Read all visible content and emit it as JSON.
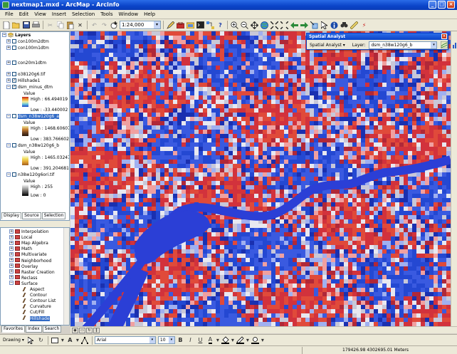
{
  "window": {
    "title": "nextmap1.mxd - ArcMap - ArcInfo",
    "minimize": "_",
    "maximize": "□",
    "close": "×"
  },
  "menu": [
    "File",
    "Edit",
    "View",
    "Insert",
    "Selection",
    "Tools",
    "Window",
    "Help"
  ],
  "toolbar": {
    "scale": "1:24,000",
    "dropdown_arrow": "▾"
  },
  "toc": {
    "root": "Layers",
    "layers": [
      {
        "name": "con100m2dtm",
        "checked": false
      },
      {
        "name": "con100m1dtm",
        "checked": false
      },
      {
        "name": "con20m1dtm",
        "checked": false
      },
      {
        "name": "o38120g6.tif",
        "checked": false
      },
      {
        "name": "Hillshade1",
        "checked": true
      },
      {
        "name": "dsm_minus_dtm",
        "checked": true,
        "legend": {
          "title": "Value",
          "high": "High : 66.494019",
          "low": "Low : -33.440002"
        }
      },
      {
        "name": "dsm_n38w120g6_a",
        "checked": false,
        "selected": true,
        "legend": {
          "title": "Value",
          "high": "High : 1468.606079",
          "low": "Low : 383.766602"
        }
      },
      {
        "name": "dsm_n38w120g6_b",
        "checked": false,
        "legend": {
          "title": "Value",
          "high": "High : 1465.032471",
          "low": "Low : 391.204681"
        }
      },
      {
        "name": "n38w120g6ori.tif",
        "checked": false,
        "legend": {
          "title": "Value",
          "high": "High : 255",
          "low": "Low : 0"
        }
      }
    ],
    "tabs": [
      "Display",
      "Source",
      "Selection"
    ]
  },
  "toolbox": {
    "items": [
      "Interpolation",
      "Local",
      "Map Algebra",
      "Math",
      "Multivariate",
      "Neighborhood",
      "Overlay",
      "Raster Creation",
      "Reclass",
      "Surface"
    ],
    "surface_tools": [
      "Aspect",
      "Contour",
      "Contour List",
      "Curvature",
      "Cut/Fill",
      "Hillshade"
    ],
    "tabs": [
      "Favorites",
      "Index",
      "Search"
    ]
  },
  "spatial_analyst": {
    "title": "Spatial Analyst",
    "menu_label": "Spatial Analyst",
    "layer_label": "Layer:",
    "layer_value": "dsm_n38w120g6_b"
  },
  "drawing": {
    "label": "Drawing",
    "font": "Arial",
    "size": "10",
    "bold": "B",
    "italic": "I",
    "underline": "U",
    "font_color_glyph": "A"
  },
  "status": {
    "coords": "179426.98  4302695.01 Meters"
  },
  "colors": {
    "accent": "#0a44c8",
    "water": "#2b3fd6",
    "relief_red": "#d2323c",
    "relief_blue": "#2448d2"
  }
}
